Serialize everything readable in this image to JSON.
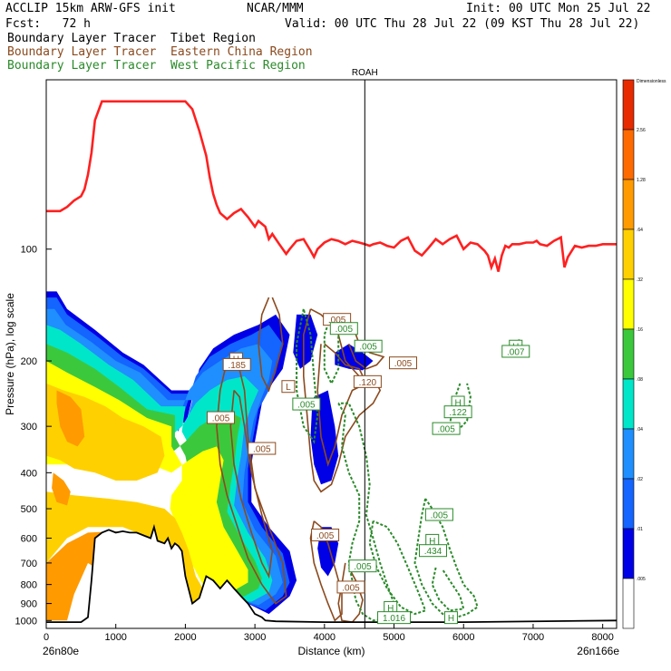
{
  "header": {
    "left_line1": "ACCLIP 15km ARW-GFS init",
    "center_line1": "NCAR/MMM",
    "right_line1": "Init: 00 UTC Mon 25 Jul 22",
    "left_line2": "Fcst:   72 h",
    "right_line2": "Valid: 00 UTC Thu 28 Jul 22 (09 KST Thu 28 Jul 22)"
  },
  "legend": [
    {
      "label": "Boundary Layer Tracer  Tibet Region",
      "color": "#000000"
    },
    {
      "label": "Boundary Layer Tracer  Eastern China Region",
      "color": "#8b4a1e"
    },
    {
      "label": "Boundary Layer Tracer  West Pacific Region",
      "color": "#2a8a2a"
    }
  ],
  "chart_data": {
    "type": "heatmap",
    "title": "",
    "xlabel": "Distance (km)",
    "ylabel": "Pressure (hPa), log scale",
    "xlim": [
      0,
      8200
    ],
    "ylim": [
      1050,
      35
    ],
    "y_scale": "log",
    "x_ticks": [
      0,
      1000,
      2000,
      3000,
      4000,
      5000,
      6000,
      7000,
      8000
    ],
    "y_ticks": [
      100,
      200,
      300,
      400,
      500,
      600,
      700,
      800,
      900,
      1000
    ],
    "x_endpoint_labels": {
      "left": "26n80e",
      "right": "26n166e"
    },
    "vertical_marker": {
      "label": "ROAH",
      "x": 4580
    },
    "colorbar": {
      "title": "Dimensionless",
      "levels": [
        "2.56",
        "1.28",
        ".64",
        ".32",
        ".16",
        ".08",
        ".04",
        ".02",
        ".01",
        ".005"
      ],
      "colors": [
        "#e82a00",
        "#ff6a00",
        "#ff9a00",
        "#ffd000",
        "#ffff00",
        "#3cc83c",
        "#00e6c8",
        "#1f8fff",
        "#1464ff",
        "#0000e6",
        "#ffffff"
      ]
    },
    "tropopause_color": "#ff2020",
    "series": [],
    "annotations": [
      {
        "text": ".005",
        "x": 4180,
        "y": 155,
        "color": "#8b4a1e"
      },
      {
        "text": ".005",
        "x": 4280,
        "y": 164,
        "color": "#2a8a2a"
      },
      {
        "text": ".005",
        "x": 4630,
        "y": 183,
        "color": "#2a8a2a"
      },
      {
        "text": ".005",
        "x": 5130,
        "y": 203,
        "color": "#8b4a1e"
      },
      {
        "text": "H",
        "x": 6750,
        "y": 183,
        "color": "#2a8a2a"
      },
      {
        "text": ".007",
        "x": 6750,
        "y": 189,
        "color": "#2a8a2a"
      },
      {
        "text": "H",
        "x": 2730,
        "y": 198,
        "color": "#8b4a1e"
      },
      {
        "text": ".185",
        "x": 2740,
        "y": 205,
        "color": "#8b4a1e"
      },
      {
        "text": "L",
        "x": 3480,
        "y": 235,
        "color": "#8b4a1e"
      },
      {
        "text": ".120",
        "x": 4620,
        "y": 228,
        "color": "#8b4a1e"
      },
      {
        "text": ".005",
        "x": 3740,
        "y": 262,
        "color": "#2a8a2a"
      },
      {
        "text": "H",
        "x": 5920,
        "y": 259,
        "color": "#2a8a2a"
      },
      {
        "text": ".122",
        "x": 5920,
        "y": 275,
        "color": "#2a8a2a"
      },
      {
        "text": ".005",
        "x": 2510,
        "y": 285,
        "color": "#8b4a1e"
      },
      {
        "text": ".005",
        "x": 5750,
        "y": 305,
        "color": "#2a8a2a"
      },
      {
        "text": ".005",
        "x": 3100,
        "y": 345,
        "color": "#8b4a1e"
      },
      {
        "text": ".005",
        "x": 5650,
        "y": 520,
        "color": "#2a8a2a"
      },
      {
        "text": ".005",
        "x": 4010,
        "y": 590,
        "color": "#8b4a1e"
      },
      {
        "text": "H",
        "x": 5550,
        "y": 610,
        "color": "#2a8a2a"
      },
      {
        "text": ".434",
        "x": 5560,
        "y": 650,
        "color": "#2a8a2a"
      },
      {
        "text": ".005",
        "x": 4550,
        "y": 715,
        "color": "#2a8a2a"
      },
      {
        "text": ".005",
        "x": 4380,
        "y": 815,
        "color": "#8b4a1e"
      },
      {
        "text": "H",
        "x": 4950,
        "y": 925,
        "color": "#2a8a2a"
      },
      {
        "text": "1.016",
        "x": 5000,
        "y": 985,
        "color": "#2a8a2a"
      },
      {
        "text": "H",
        "x": 5820,
        "y": 985,
        "color": "#2a8a2a"
      }
    ]
  }
}
